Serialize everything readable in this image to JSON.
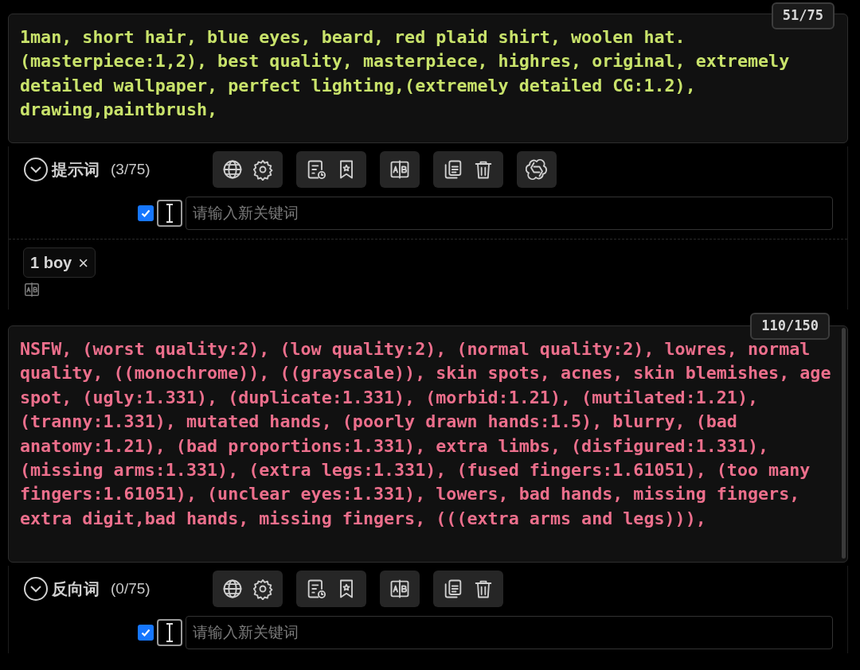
{
  "sections": [
    {
      "kind": "positive",
      "text": "1man, short hair, blue eyes, beard, red plaid shirt, woolen hat. (masterpiece:1,2), best quality, masterpiece, highres, original, extremely detailed wallpaper, perfect lighting,(extremely detailed CG:1.2), drawing,paintbrush,",
      "counter": "51/75",
      "title": "提示词",
      "count": "(3/75)",
      "expanded": true,
      "toolbar": [
        {
          "buttons": [
            {
              "kind": "globe"
            },
            {
              "kind": "gear"
            }
          ]
        },
        {
          "buttons": [
            {
              "kind": "history"
            },
            {
              "kind": "bookmark"
            }
          ]
        },
        {
          "buttons": [
            {
              "kind": "translate"
            }
          ]
        },
        {
          "buttons": [
            {
              "kind": "copy"
            },
            {
              "kind": "trash"
            }
          ]
        },
        {
          "buttons": [
            {
              "kind": "knot"
            }
          ]
        }
      ],
      "checked": true,
      "placeholder": "请输入新关键词",
      "tags": [
        {
          "label": "1 boy",
          "remove": "×"
        }
      ]
    },
    {
      "kind": "negative",
      "text": "NSFW, (worst quality:2), (low quality:2), (normal quality:2), lowres, normal quality, ((monochrome)), ((grayscale)), skin spots, acnes, skin blemishes, age spot, (ugly:1.331), (duplicate:1.331), (morbid:1.21), (mutilated:1.21), (tranny:1.331), mutated hands, (poorly drawn hands:1.5), blurry, (bad anatomy:1.21), (bad proportions:1.331), extra limbs, (disfigured:1.331), (missing arms:1.331), (extra legs:1.331), (fused fingers:1.61051), (too many fingers:1.61051), (unclear eyes:1.331), lowers, bad hands, missing fingers, extra digit,bad hands, missing fingers, (((extra arms and legs))),",
      "counter": "110/150",
      "title": "反向词",
      "count": "(0/75)",
      "expanded": true,
      "toolbar": [
        {
          "buttons": [
            {
              "kind": "globe"
            },
            {
              "kind": "gear"
            }
          ]
        },
        {
          "buttons": [
            {
              "kind": "history"
            },
            {
              "kind": "bookmark"
            }
          ]
        },
        {
          "buttons": [
            {
              "kind": "translate"
            }
          ]
        },
        {
          "buttons": [
            {
              "kind": "copy"
            },
            {
              "kind": "trash"
            }
          ]
        }
      ],
      "checked": true,
      "placeholder": "请输入新关键词"
    }
  ]
}
